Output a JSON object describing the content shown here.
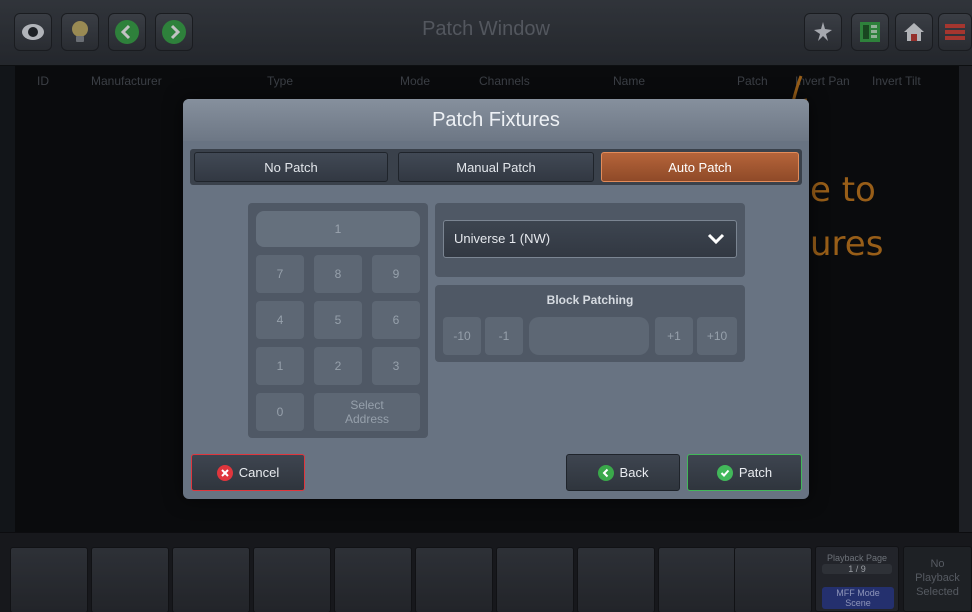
{
  "window": {
    "title": "Patch Window"
  },
  "columns": [
    "ID",
    "Manufacturer",
    "Type",
    "Mode",
    "Channels",
    "Name",
    "Patch",
    "Invert Pan",
    "Invert Tilt"
  ],
  "background_handwriting": [
    "e to",
    "ures"
  ],
  "icons": {
    "top_left": [
      "eye-icon",
      "bulb-icon",
      "chevron-left-icon",
      "chevron-right-icon"
    ],
    "top_right": [
      "wand-icon",
      "grid-icon",
      "home-icon",
      "menu-icon"
    ]
  },
  "modal": {
    "title": "Patch Fixtures",
    "tabs": [
      {
        "label": "No Patch",
        "active": false
      },
      {
        "label": "Manual Patch",
        "active": false
      },
      {
        "label": "Auto Patch",
        "active": true
      }
    ],
    "keypad": {
      "display": "1",
      "keys": [
        "7",
        "8",
        "9",
        "4",
        "5",
        "6",
        "1",
        "2",
        "3",
        "0"
      ],
      "select_address_line1": "Select",
      "select_address_line2": "Address"
    },
    "universe": {
      "selected": "Universe 1 (NW)"
    },
    "block_patching": {
      "title": "Block Patching",
      "buttons": [
        "-10",
        "-1",
        "+1",
        "+10"
      ],
      "value": ""
    },
    "cancel_label": "Cancel",
    "back_label": "Back",
    "patch_label": "Patch"
  },
  "bottom": {
    "playback_page_label": "Playback Page",
    "playback_page_value": "1 / 9",
    "mff_mode_label": "MFF Mode",
    "mff_mode_value": "Scene",
    "no_playback_line1": "No",
    "no_playback_line2": "Playback",
    "no_playback_line3": "Selected"
  },
  "colors": {
    "accent_orange": "#b5643a",
    "cancel_red": "#e0363d",
    "back_green": "#3aa84a",
    "patch_green": "#42b85a"
  }
}
